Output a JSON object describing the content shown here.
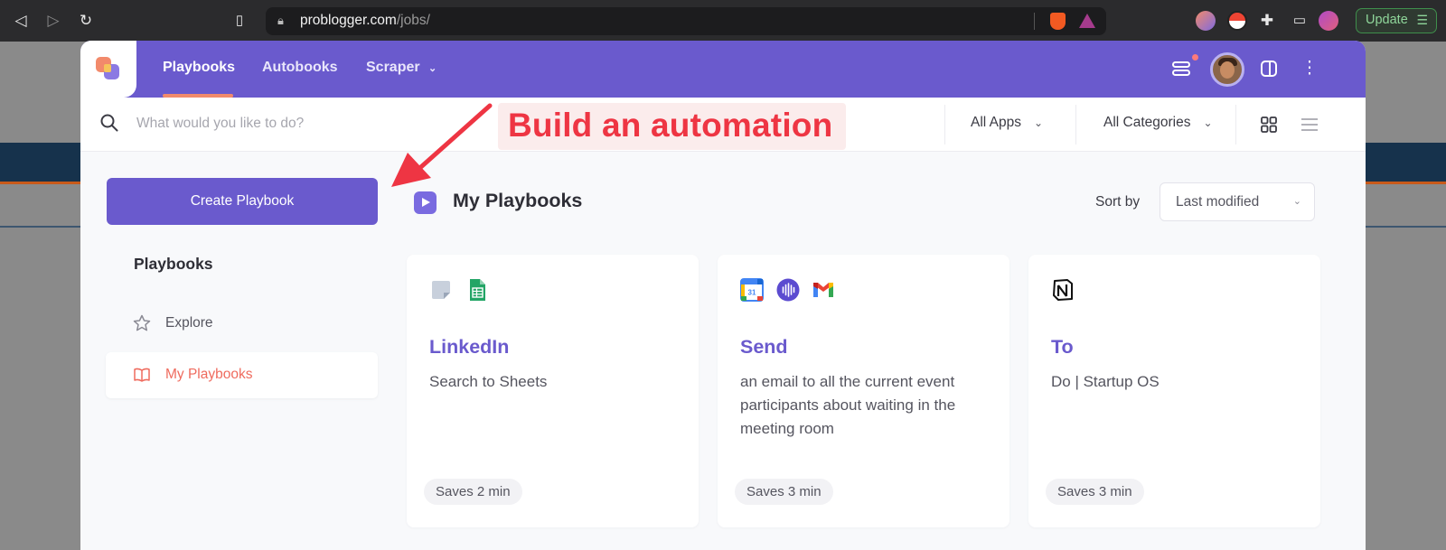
{
  "browser": {
    "url_host": "problogger.com",
    "url_path": "/jobs/",
    "update_label": "Update"
  },
  "nav": {
    "tabs": [
      {
        "label": "Playbooks",
        "active": true
      },
      {
        "label": "Autobooks",
        "active": false
      },
      {
        "label": "Scraper",
        "active": false,
        "has_dropdown": true
      }
    ]
  },
  "search": {
    "placeholder": "What would you like to do?"
  },
  "filters": {
    "apps": "All Apps",
    "categories": "All Categories"
  },
  "callout": {
    "text": "Build an automation"
  },
  "sidebar": {
    "create_label": "Create Playbook",
    "heading": "Playbooks",
    "items": [
      {
        "label": "Explore",
        "icon": "star-icon",
        "active": false
      },
      {
        "label": "My Playbooks",
        "icon": "book-icon",
        "active": true
      }
    ]
  },
  "main": {
    "title": "My Playbooks",
    "sort_label": "Sort by",
    "sort_value": "Last modified",
    "cards": [
      {
        "title": "LinkedIn",
        "description": "Search to Sheets",
        "badge": "Saves 2 min",
        "apps": [
          "sticky-note-icon",
          "google-sheets-icon"
        ]
      },
      {
        "title": "Send",
        "description": "an email to all the current event participants about waiting in the meeting room",
        "badge": "Saves 3 min",
        "apps": [
          "google-calendar-icon",
          "audio-wave-icon",
          "gmail-icon"
        ]
      },
      {
        "title": "To",
        "description": "Do | Startup OS",
        "badge": "Saves 3 min",
        "apps": [
          "notion-icon"
        ]
      }
    ]
  },
  "colors": {
    "brand": "#6a5acd",
    "accent": "#ef6b5e",
    "callout_text": "#ee3543"
  }
}
